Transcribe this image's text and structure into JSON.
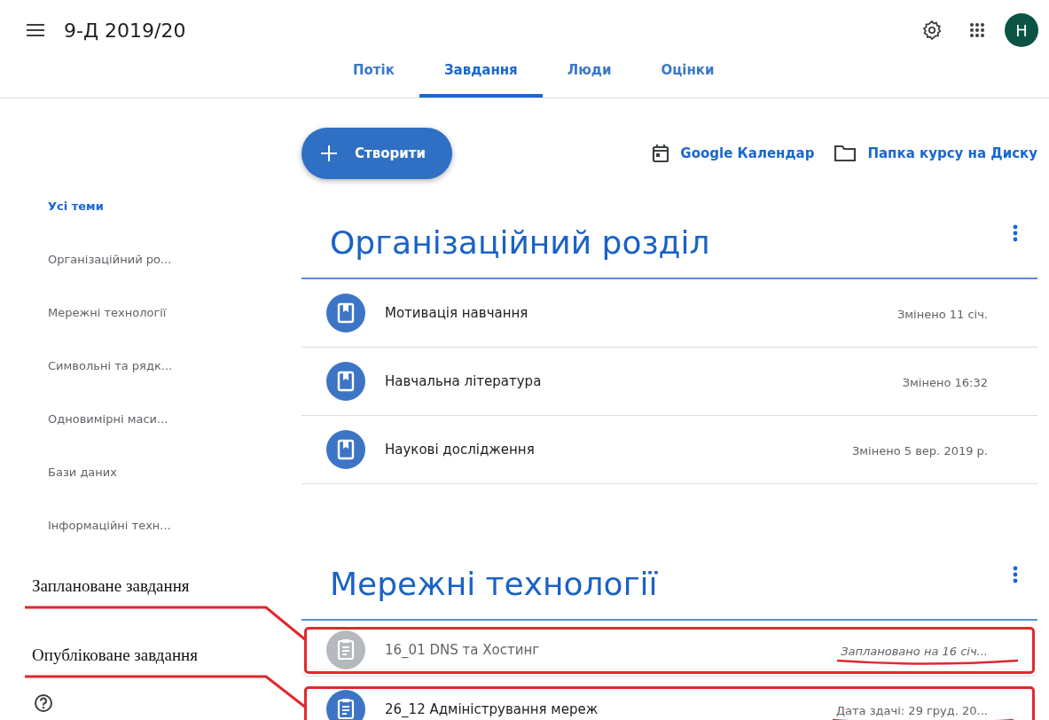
{
  "header": {
    "course_title": "9-Д 2019/20",
    "avatar_letter": "H"
  },
  "tabs": [
    {
      "label": "Потік",
      "selected": false
    },
    {
      "label": "Завдання",
      "selected": true
    },
    {
      "label": "Люди",
      "selected": false
    },
    {
      "label": "Оцінки",
      "selected": false
    }
  ],
  "toolbar": {
    "create_button": "Створити",
    "links": [
      {
        "kind": "calendar",
        "label": "Google Календар"
      },
      {
        "kind": "folder",
        "label": "Папка курсу на Диску"
      }
    ]
  },
  "sidebar": {
    "items": [
      {
        "label": "Усі теми",
        "selected": true
      },
      {
        "label": "Організаційний ро...",
        "selected": false
      },
      {
        "label": "Мережні технології",
        "selected": false
      },
      {
        "label": "Символьні та рядк...",
        "selected": false
      },
      {
        "label": "Одновимірні маси...",
        "selected": false
      },
      {
        "label": "Бази даних",
        "selected": false
      },
      {
        "label": "Інформаційні техн...",
        "selected": false
      }
    ]
  },
  "topics": [
    {
      "title": "Організаційний розділ",
      "items": [
        {
          "kind": "material",
          "title": "Мотивація навчання",
          "date": "Змінено 11 січ.",
          "scheduled": false,
          "annotated": false
        },
        {
          "kind": "material",
          "title": "Навчальна література",
          "date": "Змінено 16:32",
          "scheduled": false,
          "annotated": false
        },
        {
          "kind": "material",
          "title": "Наукові дослідження",
          "date": "Змінено 5 вер. 2019 р.",
          "scheduled": false,
          "annotated": false
        }
      ]
    },
    {
      "title": "Мережні технології",
      "items": [
        {
          "kind": "assignment",
          "title": "16_01 DNS та Хостинг",
          "date": "Заплановано на 16 січ...",
          "scheduled": true,
          "annotated": true
        },
        {
          "kind": "assignment",
          "title": "26_12 Адміністрування мереж",
          "date": "Дата здачі: 29 груд. 20...",
          "scheduled": false,
          "annotated": true
        }
      ]
    }
  ],
  "annotations": [
    {
      "label": "Заплановане завдання"
    },
    {
      "label": "Опубліковане завдання"
    }
  ]
}
